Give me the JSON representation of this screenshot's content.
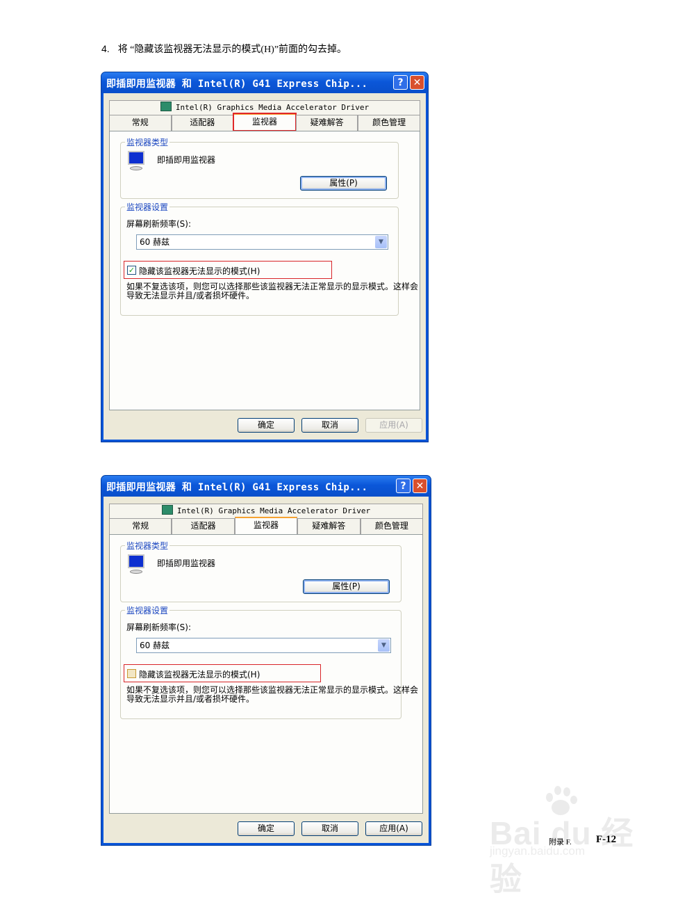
{
  "instruction": {
    "number": "4.",
    "text": "将 “隐藏该监视器无法显示的模式(H)”前面的勾去掉。"
  },
  "dialog_common": {
    "title": "即插即用监视器 和 Intel(R) G41 Express Chip...",
    "help_button": "?",
    "close_button": "✕",
    "driver_tab": "Intel(R) Graphics Media Accelerator Driver",
    "tabs": [
      "常规",
      "适配器",
      "监视器",
      "疑难解答",
      "颜色管理"
    ],
    "active_tab_index": 2,
    "monitor_type_group": "监视器类型",
    "monitor_name": "即插即用监视器",
    "properties_button": "属性(P)",
    "monitor_settings_group": "监视器设置",
    "refresh_label": "屏幕刷新频率(S):",
    "refresh_value": "60 赫兹",
    "hide_modes_label": "隐藏该监视器无法显示的模式(H)",
    "description": "如果不复选该项，则您可以选择那些该监视器无法正常显示的显示模式。这样会导致无法显示并且/或者损坏硬件。",
    "ok_button": "确定",
    "cancel_button": "取消",
    "apply_button": "应用(A)"
  },
  "dialog_before": {
    "hide_modes_checked": true,
    "apply_enabled": false
  },
  "dialog_after": {
    "hide_modes_checked": false,
    "apply_enabled": true
  },
  "footer": {
    "label": "附录 F.",
    "page": "F-12"
  },
  "watermark": {
    "text": "Bai du 经验",
    "sub": "jingyan.baidu.com"
  },
  "colors": {
    "title_bar": "#0b57d9",
    "dialog_bg": "#ece9d8",
    "highlight_box": "#e0282a",
    "group_label": "#1a46c0"
  }
}
